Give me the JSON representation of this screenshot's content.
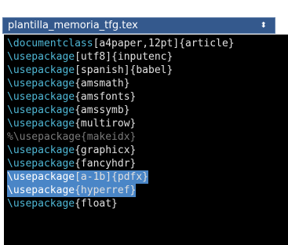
{
  "header": {
    "title": "plantilla_memoria_tfg.tex",
    "spinner_icon": "⬍"
  },
  "lines": [
    {
      "cmd": "\\documentclass",
      "arg": "[a4paper,12pt]{article}",
      "type": "code"
    },
    {
      "cmd": "\\usepackage",
      "arg": "[utf8]{inputenc}",
      "type": "code"
    },
    {
      "cmd": "\\usepackage",
      "arg": "[spanish]{babel}",
      "type": "code"
    },
    {
      "cmd": "\\usepackage",
      "arg": "{amsmath}",
      "type": "code"
    },
    {
      "cmd": "\\usepackage",
      "arg": "{amsfonts}",
      "type": "code"
    },
    {
      "cmd": "\\usepackage",
      "arg": "{amssymb}",
      "type": "code"
    },
    {
      "cmd": "\\usepackage",
      "arg": "{multirow}",
      "type": "code"
    },
    {
      "cmd": "%\\usepackage{makeidx}",
      "arg": "",
      "type": "comment"
    },
    {
      "cmd": "\\usepackage",
      "arg": "{graphicx}",
      "type": "code"
    },
    {
      "cmd": "\\usepackage",
      "arg": "{fancyhdr}",
      "type": "code"
    },
    {
      "cmd": "\\usepackage",
      "arg": "[a-1b]{pdfx}",
      "type": "selected"
    },
    {
      "cmd": "\\usepackage",
      "arg": "{hyperref}",
      "type": "selected"
    },
    {
      "cmd": "\\usepackage",
      "arg": "{float}",
      "type": "code"
    }
  ]
}
